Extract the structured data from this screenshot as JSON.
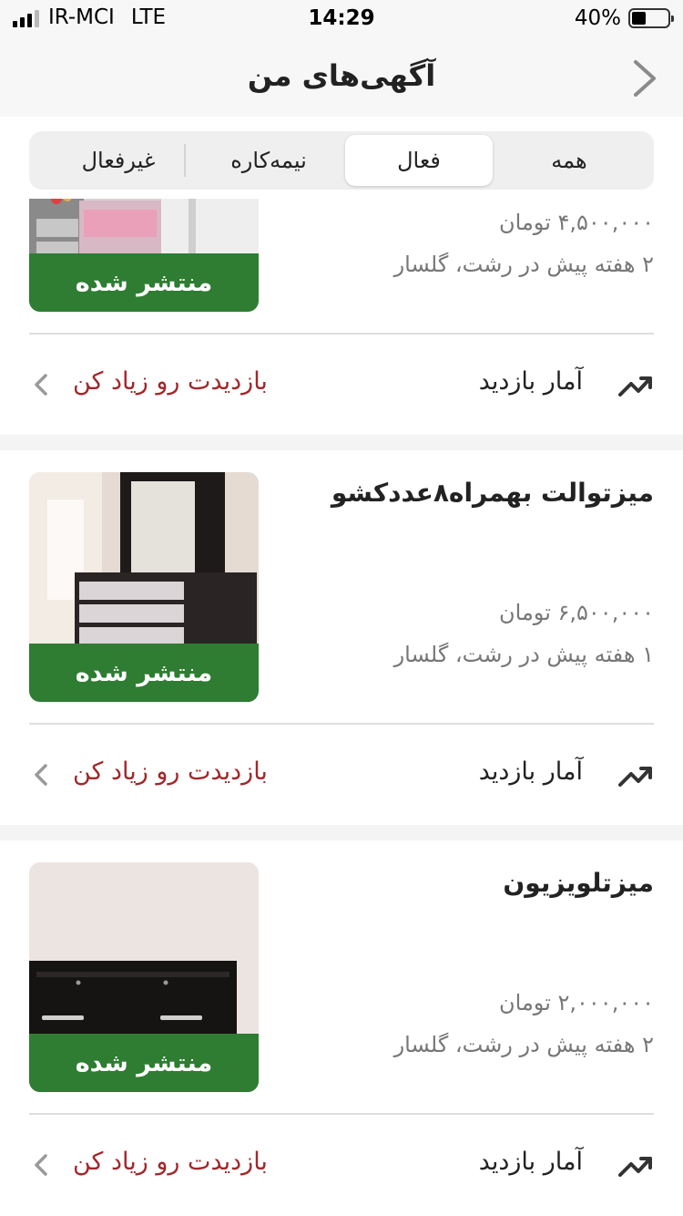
{
  "status_bar": {
    "carrier": "IR-MCI",
    "network": "LTE",
    "time": "14:29",
    "battery_percent": "40%",
    "battery_level": 0.4
  },
  "nav": {
    "title": "آگهی‌های من",
    "back_icon": "chevron-right-icon"
  },
  "tabs": [
    {
      "label": "همه",
      "active": false
    },
    {
      "label": "فعال",
      "active": true
    },
    {
      "label": "نیمه‌کاره",
      "active": false
    },
    {
      "label": "غیرفعال",
      "active": false
    }
  ],
  "listings": [
    {
      "title": "",
      "price": "۴,۵۰۰,۰۰۰ تومان",
      "meta": "۲ هفته پیش در رشت، گلسار",
      "status": "منتشر شده",
      "stats_label": "آمار بازدید",
      "boost_label": "بازدیدت رو زیاد کن",
      "image": "bedroom-furniture"
    },
    {
      "title": "میزتوالت بهمراه۸عددکشو",
      "price": "۶,۵۰۰,۰۰۰ تومان",
      "meta": "۱ هفته پیش در رشت، گلسار",
      "status": "منتشر شده",
      "stats_label": "آمار بازدید",
      "boost_label": "بازدیدت رو زیاد کن",
      "image": "dressing-table"
    },
    {
      "title": "میزتلویزیون",
      "price": "۲,۰۰۰,۰۰۰ تومان",
      "meta": "۲ هفته پیش در رشت، گلسار",
      "status": "منتشر شده",
      "stats_label": "آمار بازدید",
      "boost_label": "بازدیدت رو زیاد کن",
      "image": "tv-stand"
    }
  ],
  "colors": {
    "published_green": "#2e7d32",
    "boost_red": "#a0282a",
    "muted_text": "#777777"
  }
}
